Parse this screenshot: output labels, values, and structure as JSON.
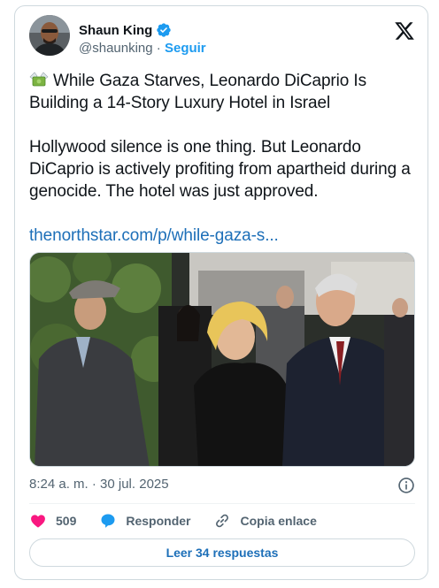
{
  "author": {
    "display_name": "Shaun King",
    "handle": "@shaunking",
    "separator": " · ",
    "follow_label": "Seguir"
  },
  "tweet": {
    "headline": "While Gaza Starves, Leonardo DiCaprio Is Building a 14-Story Luxury Hotel in Israel",
    "body": "Hollywood silence is one thing. But Leonardo DiCaprio is actively profiting from apartheid during a genocide. The hotel was just approved.",
    "link_text": "thenorthstar.com/p/while-gaza-s..."
  },
  "meta": {
    "timestamp": "8:24 a. m. · 30 jul. 2025"
  },
  "actions": {
    "likes_count": "509",
    "reply_label": "Responder",
    "copy_label": "Copia enlace"
  },
  "read_replies_label": "Leer 34 respuestas",
  "icons": {
    "headline_emoji": "money-with-wings-icon",
    "verified": "verified-badge-icon",
    "platform": "x-logo-icon",
    "info": "info-icon",
    "like": "heart-icon",
    "reply": "speech-bubble-icon",
    "copy": "link-icon"
  },
  "colors": {
    "link": "#1d6fb8",
    "follow": "#1d9bf0",
    "like": "#f91880",
    "reply": "#1d9bf0",
    "secondary_text": "#536471",
    "border": "#cfd9de"
  }
}
